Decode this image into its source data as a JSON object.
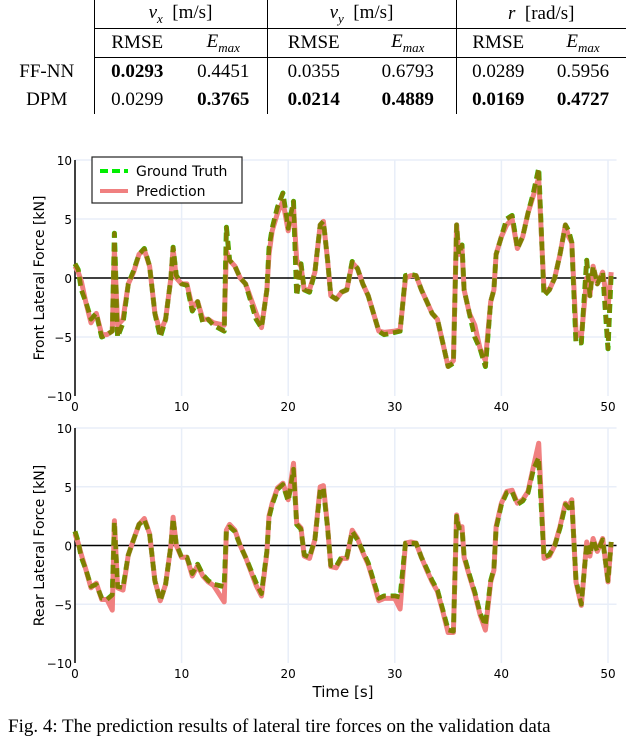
{
  "table": {
    "groups": [
      {
        "symbol": "v",
        "sub": "x",
        "unit": "[m/s]"
      },
      {
        "symbol": "v",
        "sub": "y",
        "unit": "[m/s]"
      },
      {
        "symbol": "r",
        "sub": "",
        "unit": "[rad/s]"
      }
    ],
    "subheaders": [
      "RMSE",
      "E",
      "max"
    ],
    "rows": [
      {
        "label": "FF-NN",
        "values": [
          "0.0293",
          "0.4451",
          "0.0355",
          "0.6793",
          "0.0289",
          "0.5956"
        ],
        "bold": [
          true,
          false,
          false,
          false,
          false,
          false
        ]
      },
      {
        "label": "DPM",
        "values": [
          "0.0299",
          "0.3765",
          "0.0214",
          "0.4889",
          "0.0169",
          "0.4727"
        ],
        "bold": [
          false,
          true,
          true,
          true,
          true,
          true
        ]
      }
    ]
  },
  "caption": "Fig. 4: The prediction results of lateral tire forces on the validation data",
  "chart_data": [
    {
      "type": "line",
      "title": "",
      "xlabel": "",
      "ylabel": "Front Lateral Force [kN]",
      "xlim": [
        0,
        50.5
      ],
      "ylim": [
        -10,
        10
      ],
      "xticks": [
        0,
        10,
        20,
        30,
        40,
        50
      ],
      "yticks": [
        -10,
        -5,
        0,
        5,
        10
      ],
      "grid": true,
      "legend": "top-left",
      "colors": {
        "ground_truth": "#00ee00",
        "prediction": "#f08080",
        "overlap": "#7f7f00"
      },
      "x": [
        0,
        0.3,
        0.6,
        1,
        1.5,
        2,
        2.5,
        3,
        3.5,
        3.7,
        4,
        4.5,
        5,
        5.5,
        6,
        6.5,
        7,
        7.5,
        8,
        8.5,
        9,
        9.2,
        9.5,
        10,
        10.5,
        11,
        11.5,
        12,
        12.5,
        13,
        14,
        14.2,
        14.5,
        15,
        15.5,
        16,
        17,
        17.5,
        18,
        18.2,
        18.5,
        19,
        19.5,
        20,
        20.5,
        20.8,
        21.2,
        21.5,
        22,
        22.5,
        23,
        23.3,
        23.7,
        24,
        24.5,
        25,
        25.5,
        26,
        26.5,
        27,
        27.5,
        28,
        28.5,
        29,
        30,
        30.5,
        31,
        31.5,
        32,
        32.5,
        33,
        33.5,
        34,
        34.5,
        35,
        35.5,
        35.8,
        36,
        36.3,
        36.5,
        37,
        37.5,
        38,
        38.5,
        39,
        39.3,
        39.5,
        40,
        40.5,
        41,
        41.5,
        42,
        42.5,
        43,
        43.5,
        44,
        44.5,
        45,
        45.5,
        46,
        46.3,
        46.6,
        47,
        47.5,
        48,
        48.3,
        48.6,
        49,
        49.5,
        50,
        50.3
      ],
      "series": [
        {
          "name": "Ground Truth",
          "values": [
            1.2,
            0.7,
            -1,
            -2,
            -3.5,
            -3,
            -5,
            -4.8,
            -4.5,
            3.8,
            -5,
            -3.8,
            -0.5,
            0.6,
            2,
            2.5,
            1,
            -3,
            -5,
            -3.5,
            0,
            2.6,
            0.2,
            -0.5,
            -0.6,
            -2.8,
            -2,
            -3.8,
            -3.5,
            -4,
            -4.5,
            4.3,
            1.5,
            1,
            0,
            -0.5,
            -3.5,
            -4.2,
            -1,
            2.5,
            4.2,
            6,
            7.2,
            4.2,
            6.5,
            -1.5,
            1.2,
            -1,
            -1.2,
            0.5,
            4.5,
            4.8,
            1.5,
            -1.5,
            -1.8,
            -1.2,
            -1,
            1.4,
            0.8,
            -0.5,
            -1.5,
            -3,
            -4.5,
            -4.8,
            -4.6,
            -4.5,
            0.2,
            0.3,
            0.2,
            -1,
            -2,
            -3,
            -3.5,
            -5.5,
            -7.5,
            -7.2,
            4.5,
            2,
            2.8,
            -1,
            -3,
            -5,
            -6,
            -7.5,
            -2,
            -1,
            2,
            3.5,
            5,
            5.3,
            2.5,
            3.5,
            5.5,
            7.2,
            9.3,
            -1.5,
            -1,
            0,
            2,
            4.5,
            4,
            3,
            -5.5,
            -5.5,
            1.5,
            -1.5,
            1,
            -0.5,
            0.5,
            -6,
            0.5
          ]
        },
        {
          "name": "Prediction",
          "values": [
            1,
            0.5,
            -0.3,
            -2,
            -3.8,
            -3,
            -4.8,
            -4.8,
            -4.5,
            2.5,
            -4,
            -3.5,
            -0.5,
            0.5,
            2,
            2.4,
            1,
            -3,
            -4.6,
            -3.5,
            0,
            2.5,
            0,
            -0.5,
            -0.5,
            -2.5,
            -2,
            -3.5,
            -3.5,
            -3.8,
            -4,
            2.3,
            1.5,
            1,
            0,
            -0.5,
            -3,
            -4.2,
            -1,
            2,
            4,
            5.5,
            6.5,
            4,
            6,
            1.5,
            1,
            -1,
            -1,
            0.5,
            4.5,
            4.8,
            1.5,
            -1.5,
            -1.8,
            -1.2,
            -1,
            1.3,
            0.8,
            -0.5,
            -1.5,
            -3,
            -4.5,
            -4.6,
            -4.5,
            -4.4,
            0,
            0.2,
            0.2,
            -1,
            -2,
            -3,
            -3.5,
            -5.5,
            -7.5,
            -7,
            4.5,
            2,
            2.5,
            -1,
            -3,
            -4,
            -6,
            -7,
            -2,
            -1,
            2,
            3.5,
            4.5,
            5,
            2.5,
            3.5,
            5.5,
            7,
            8.5,
            -1,
            -1,
            0,
            2,
            4.5,
            3.5,
            3,
            -4.5,
            -5,
            0,
            -1.5,
            1,
            -0.5,
            0.5,
            -2.5,
            0.5
          ]
        }
      ]
    },
    {
      "type": "line",
      "title": "",
      "xlabel": "Time [s]",
      "ylabel": "Rear Lateral Force [kN]",
      "xlim": [
        0,
        50.5
      ],
      "ylim": [
        -10,
        10
      ],
      "xticks": [
        0,
        10,
        20,
        30,
        40,
        50
      ],
      "yticks": [
        -10,
        -5,
        0,
        5,
        10
      ],
      "grid": true,
      "legend": "none",
      "colors": {
        "ground_truth": "#00ee00",
        "prediction": "#f08080",
        "overlap": "#7f7f00"
      },
      "x": [
        0,
        0.3,
        0.6,
        1,
        1.5,
        2,
        2.5,
        3,
        3.5,
        3.7,
        4,
        4.5,
        5,
        5.5,
        6,
        6.5,
        7,
        7.5,
        8,
        8.5,
        9,
        9.2,
        9.5,
        10,
        10.5,
        11,
        11.5,
        12,
        12.5,
        13,
        14,
        14.2,
        14.5,
        15,
        15.5,
        16,
        17,
        17.5,
        18,
        18.2,
        18.5,
        19,
        19.5,
        20,
        20.5,
        20.8,
        21.2,
        21.5,
        22,
        22.5,
        23,
        23.3,
        23.7,
        24,
        24.5,
        25,
        25.5,
        26,
        26.5,
        27,
        27.5,
        28,
        28.5,
        29,
        30,
        30.5,
        31,
        31.5,
        32,
        32.5,
        33,
        33.5,
        34,
        34.5,
        35,
        35.5,
        35.8,
        36,
        36.3,
        36.5,
        37,
        37.5,
        38,
        38.5,
        39,
        39.3,
        39.5,
        40,
        40.5,
        41,
        41.5,
        42,
        42.5,
        43,
        43.5,
        44,
        44.5,
        45,
        45.5,
        46,
        46.3,
        46.6,
        47,
        47.5,
        48,
        48.3,
        48.6,
        49,
        49.5,
        50,
        50.3
      ],
      "series": [
        {
          "name": "Ground Truth",
          "values": [
            1.2,
            0.3,
            -1,
            -2,
            -3.5,
            -3.3,
            -4.5,
            -4.6,
            -4.2,
            2,
            -3.5,
            -3.6,
            -0.8,
            0.5,
            1.8,
            2.2,
            1,
            -3,
            -4.7,
            -3.3,
            0,
            2.3,
            0.1,
            -1,
            -1,
            -2.4,
            -1.6,
            -2.5,
            -3,
            -3.3,
            -3.5,
            1.3,
            1.6,
            1.2,
            0,
            -1,
            -3.2,
            -4.1,
            -0.5,
            2.4,
            3.5,
            4.8,
            5.2,
            3.8,
            6.5,
            1.8,
            1.4,
            -0.8,
            -1,
            0.5,
            4.8,
            4.9,
            1.5,
            -1.7,
            -1.8,
            -1,
            -1,
            1.2,
            0.5,
            -0.5,
            -1.5,
            -3,
            -4.5,
            -4.3,
            -4.3,
            -4.4,
            0.2,
            0.2,
            0.2,
            -1,
            -2,
            -3,
            -3.8,
            -5.5,
            -7.2,
            -7.3,
            2.5,
            1.5,
            1.5,
            -0.9,
            -2.5,
            -4,
            -5.8,
            -6.8,
            -3,
            -2,
            1.5,
            3.5,
            4.5,
            4.6,
            3.5,
            3.8,
            4.5,
            6.5,
            7.5,
            -1,
            -0.8,
            0,
            1.5,
            3.5,
            3.2,
            3.8,
            -3,
            -5,
            0.2,
            -0.8,
            0.5,
            -0.5,
            0.5,
            -3,
            0.3
          ]
        },
        {
          "name": "Prediction",
          "values": [
            1,
            0.2,
            -0.8,
            -2,
            -3.6,
            -3.2,
            -4.6,
            -4.6,
            -5.5,
            2.1,
            -3.6,
            -3.8,
            -0.8,
            0.5,
            1.8,
            2.3,
            1,
            -3,
            -4.7,
            -3.3,
            0,
            2.4,
            0,
            -1,
            -1,
            -2.6,
            -1.7,
            -2.6,
            -3.1,
            -3.4,
            -4.8,
            1.3,
            1.8,
            1.3,
            0,
            -1,
            -3.4,
            -4.3,
            -0.6,
            2.5,
            3.6,
            4.9,
            5.3,
            3.9,
            7,
            1.9,
            1.5,
            -0.9,
            -1.1,
            0.5,
            5,
            5.1,
            1.6,
            -1.8,
            -1.9,
            -1.1,
            -1.1,
            1.3,
            0.6,
            -0.6,
            -1.6,
            -3.1,
            -4.7,
            -4.5,
            -4.5,
            -5.4,
            0.2,
            0.3,
            0.2,
            -1,
            -2.1,
            -3.1,
            -3.9,
            -5.6,
            -7.4,
            -7.4,
            2.6,
            1.6,
            1.6,
            -1,
            -2.6,
            -4.1,
            -5.9,
            -7.2,
            -3.1,
            -2.1,
            1.6,
            3.6,
            4.6,
            4.7,
            3.6,
            3.9,
            4.6,
            6.7,
            8.7,
            -1.1,
            -0.9,
            0,
            1.6,
            3.6,
            3.3,
            3.9,
            -3.1,
            -5.1,
            0.3,
            -0.9,
            0.6,
            -0.5,
            0.6,
            -3.1,
            0.3
          ]
        }
      ]
    }
  ],
  "legend": {
    "ground_truth_label": "Ground Truth",
    "prediction_label": "Prediction"
  }
}
